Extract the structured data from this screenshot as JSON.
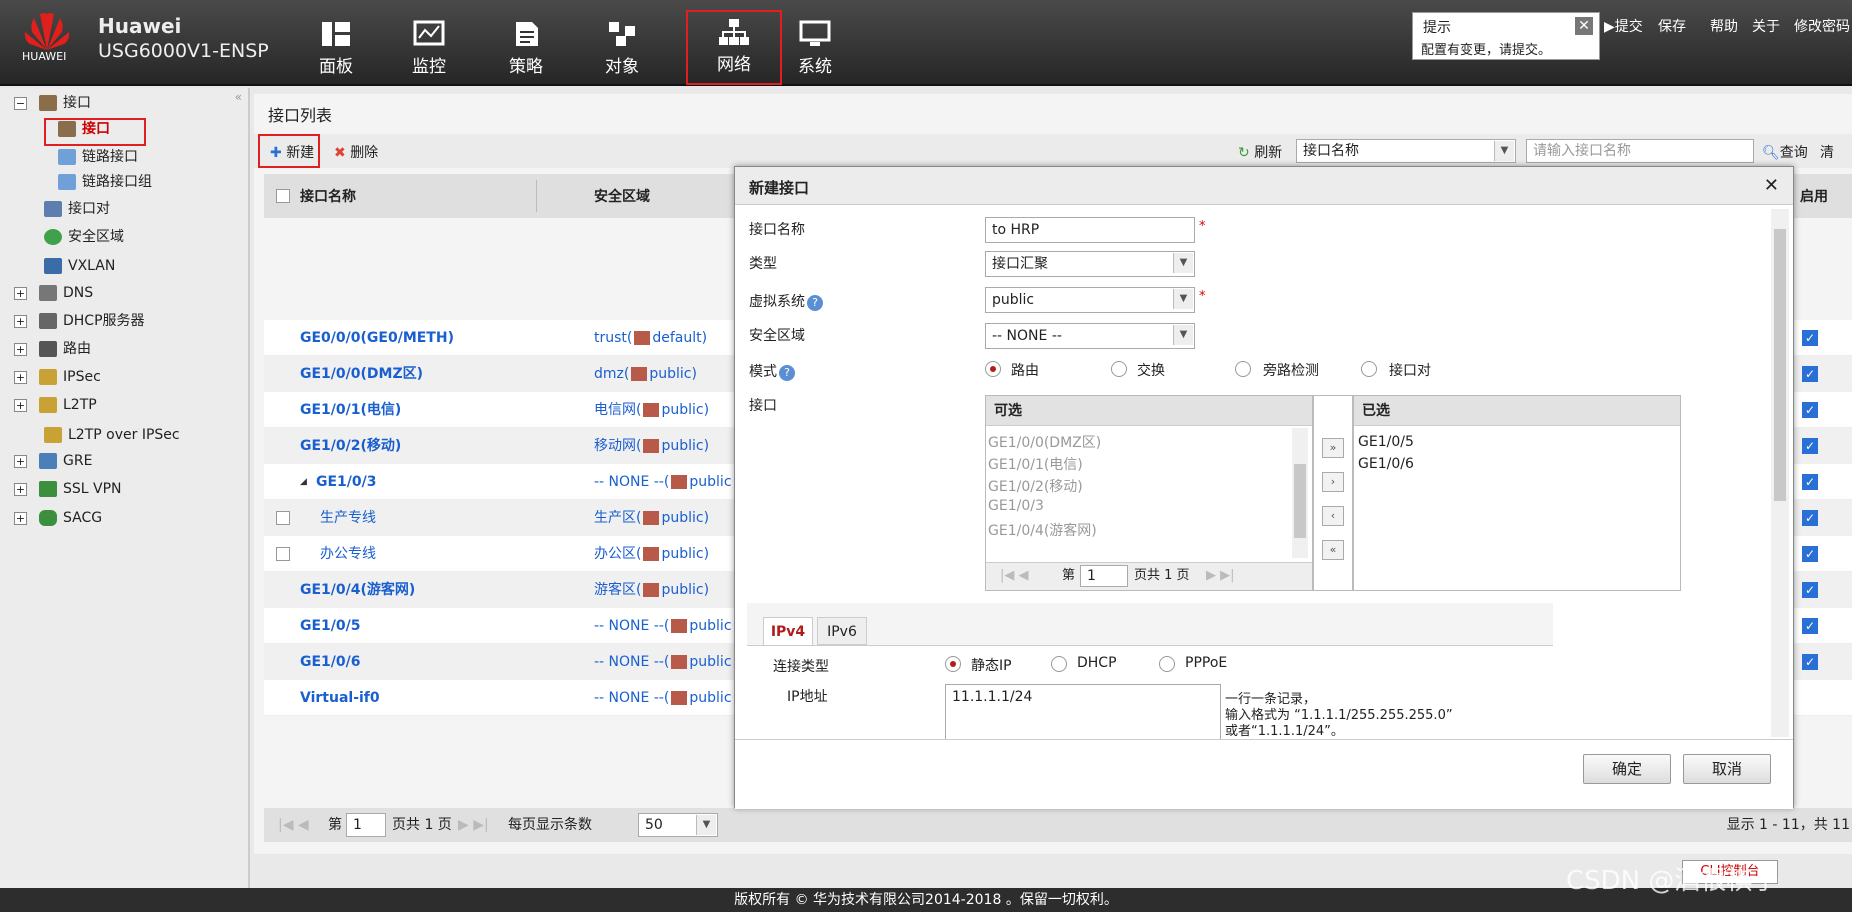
{
  "header": {
    "brand": "Huawei",
    "model": "USG6000V1-ENSP",
    "logo_text": "HUAWEI",
    "nav": [
      {
        "label": "面板",
        "icon": "dashboard-icon"
      },
      {
        "label": "监控",
        "icon": "monitor-icon"
      },
      {
        "label": "策略",
        "icon": "policy-icon"
      },
      {
        "label": "对象",
        "icon": "object-icon"
      },
      {
        "label": "网络",
        "icon": "network-icon"
      },
      {
        "label": "系统",
        "icon": "system-icon"
      }
    ],
    "links": [
      "▶提交",
      "保存",
      "帮助",
      "关于",
      "修改密码"
    ],
    "hint": {
      "title": "提示",
      "message": "配置有变更，请提交。"
    }
  },
  "sidebar": {
    "items": [
      "接口",
      "接口",
      "链路接口",
      "链路接口组",
      "接口对",
      "安全区域",
      "VXLAN",
      "DNS",
      "DHCP服务器",
      "路由",
      "IPSec",
      "L2TP",
      "L2TP over IPSec",
      "GRE",
      "SSL VPN",
      "SACG"
    ]
  },
  "main": {
    "title": "接口列表",
    "new": "新建",
    "delete": "删除",
    "refresh": "刷新",
    "search_field": "接口名称",
    "search_placeholder": "请输入接口名称",
    "query": "查询",
    "clear": "清",
    "columns": {
      "name": "接口名称",
      "zone": "安全区域",
      "enable": "启用"
    },
    "rows": [
      {
        "name": "GE0/0/0(GE0/METH)",
        "zone_a": "trust(",
        "zone_b": "default)"
      },
      {
        "name": "GE1/0/0(DMZ区)",
        "zone_a": "dmz(",
        "zone_b": "public)"
      },
      {
        "name": "GE1/0/1(电信)",
        "zone_a": "电信网(",
        "zone_b": "public)"
      },
      {
        "name": "GE1/0/2(移动)",
        "zone_a": "移动网(",
        "zone_b": "public)"
      },
      {
        "name": "GE1/0/3",
        "zone_a": "-- NONE --(",
        "zone_b": "public"
      },
      {
        "name": "生产专线",
        "zone_a": "生产区(",
        "zone_b": "public)"
      },
      {
        "name": "办公专线",
        "zone_a": "办公区(",
        "zone_b": "public)"
      },
      {
        "name": "GE1/0/4(游客网)",
        "zone_a": "游客区(",
        "zone_b": "public)"
      },
      {
        "name": "GE1/0/5",
        "zone_a": "-- NONE --(",
        "zone_b": "public"
      },
      {
        "name": "GE1/0/6",
        "zone_a": "-- NONE --(",
        "zone_b": "public"
      },
      {
        "name": "Virtual-if0",
        "zone_a": "-- NONE --(",
        "zone_b": "public"
      }
    ],
    "pager": {
      "page_label": "第",
      "page": "1",
      "total": "页共 1 页",
      "per_page_label": "每页显示条数",
      "per_page": "50",
      "summary": "显示 1 - 11，共 11"
    }
  },
  "dialog": {
    "title": "新建接口",
    "labels": {
      "name": "接口名称",
      "type": "类型",
      "vsys": "虚拟系统",
      "zone": "安全区域",
      "mode": "模式",
      "iface": "接口"
    },
    "name_value": "to HRP",
    "type_value": "接口汇聚",
    "vsys_value": "public",
    "zone_value": "-- NONE --",
    "modes": [
      "路由",
      "交换",
      "旁路检测",
      "接口对"
    ],
    "available_title": "可选",
    "available": [
      "GE1/0/0(DMZ区)",
      "GE1/0/1(电信)",
      "GE1/0/2(移动)",
      "GE1/0/3",
      "GE1/0/4(游客网)"
    ],
    "avail_pager": {
      "page_label": "第",
      "page": "1",
      "total": "页共 1 页"
    },
    "selected_title": "已选",
    "selected": [
      "GE1/0/5",
      "GE1/0/6"
    ],
    "tabs": [
      "IPv4",
      "IPv6"
    ],
    "conn_label": "连接类型",
    "conn_types": [
      "静态IP",
      "DHCP",
      "PPPoE"
    ],
    "ip_label": "IP地址",
    "ip_value": "11.1.1.1/24",
    "ip_hint": [
      "一行一条记录，",
      "输入格式为 “1.1.1.1/255.255.255.0”",
      "或者“1.1.1.1/24”。"
    ],
    "ok": "确定",
    "cancel": "取消"
  },
  "footer": {
    "copyright": "版权所有 © 华为技术有限公司2014-2018 。保留一切权利。",
    "cli": "CLI控制台",
    "watermark": "CSDN @酒很棋子"
  }
}
